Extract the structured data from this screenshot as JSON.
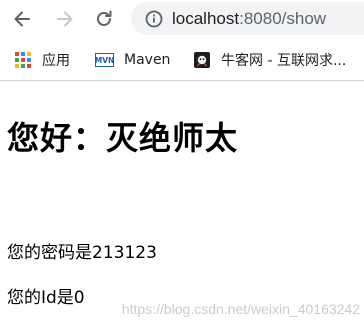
{
  "browser": {
    "url_host": "localhost",
    "url_rest": ":8080/show",
    "icons": {
      "back": "back-arrow-icon",
      "forward": "forward-arrow-icon",
      "reload": "reload-icon",
      "site_info": "info-icon"
    }
  },
  "bookmarks": [
    {
      "label": "应用",
      "icon": "apps-grid-icon"
    },
    {
      "label": "Maven",
      "icon": "maven-icon"
    },
    {
      "label": "牛客网 - 互联网求...",
      "icon": "nowcoder-icon"
    }
  ],
  "page": {
    "greeting": "您好：灭绝师太",
    "password_line": "您的密码是213123",
    "id_line": "您的Id是0"
  },
  "watermark": "https://blog.csdn.net/weixin_40163242"
}
